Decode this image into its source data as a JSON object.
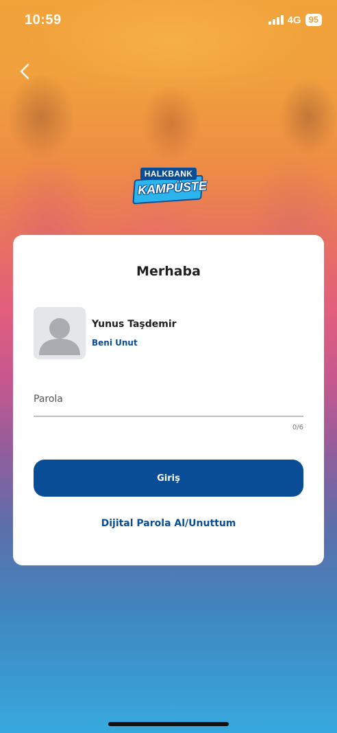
{
  "status_bar": {
    "time": "10:59",
    "network": "4G",
    "battery": "95"
  },
  "logo": {
    "top_text": "HALKBANK",
    "bottom_text": "KAMPÜSTE"
  },
  "card": {
    "title": "Merhaba",
    "user_name": "Yunus Taşdemir",
    "forget_label": "Beni Unut",
    "password_placeholder": "Parola",
    "char_counter": "0/6",
    "login_label": "Giriş",
    "digital_password_label": "Dijital Parola Al/Unuttum"
  },
  "colors": {
    "primary": "#0a4d97",
    "card_background": "#ffffff"
  }
}
